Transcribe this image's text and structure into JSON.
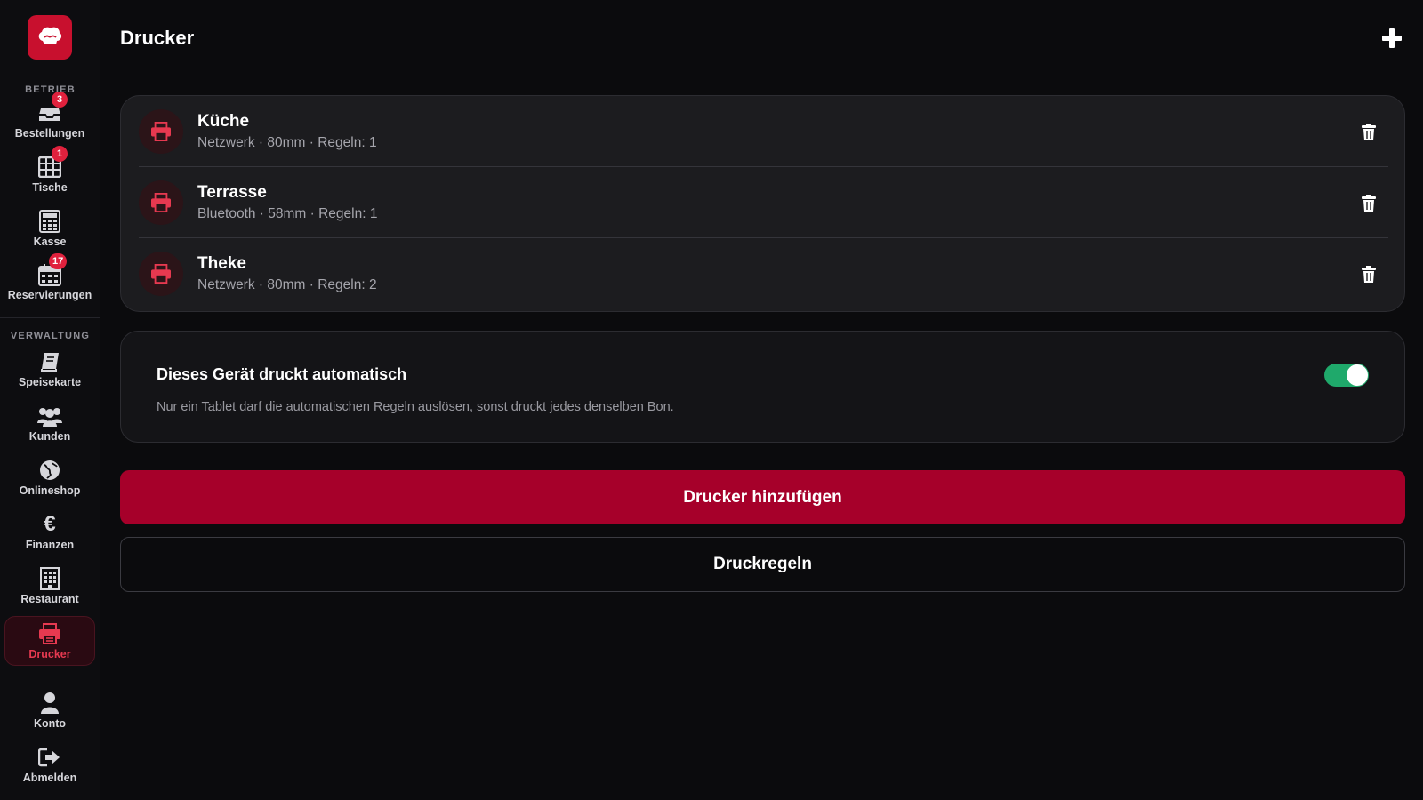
{
  "app": {
    "logo_icon": "chef-hat-icon",
    "brand_color": "#c8102e"
  },
  "sidebar": {
    "section_operation": "BETRIEB",
    "section_management": "VERWALTUNG",
    "items": [
      {
        "label": "Bestellungen",
        "icon": "inbox-tray-icon",
        "badge": "3"
      },
      {
        "label": "Tische",
        "icon": "table-grid-icon",
        "badge": "1"
      },
      {
        "label": "Kasse",
        "icon": "calculator-icon"
      },
      {
        "label": "Reservierungen",
        "icon": "calendar-icon",
        "badge": "17"
      },
      {
        "label": "Speisekarte",
        "icon": "book-icon"
      },
      {
        "label": "Kunden",
        "icon": "users-icon"
      },
      {
        "label": "Onlineshop",
        "icon": "globe-icon"
      },
      {
        "label": "Finanzen",
        "icon": "euro-icon"
      },
      {
        "label": "Restaurant",
        "icon": "building-icon"
      },
      {
        "label": "Drucker",
        "icon": "printer-icon",
        "active": true
      },
      {
        "label": "Konto",
        "icon": "user-icon"
      },
      {
        "label": "Abmelden",
        "icon": "logout-icon"
      }
    ]
  },
  "header": {
    "title": "Drucker",
    "add_icon": "plus-icon"
  },
  "printers": [
    {
      "name": "Küche",
      "meta": "Netzwerk · 80mm · Regeln: 1"
    },
    {
      "name": "Terrasse",
      "meta": "Bluetooth · 58mm · Regeln: 1"
    },
    {
      "name": "Theke",
      "meta": "Netzwerk · 80mm · Regeln: 2"
    }
  ],
  "auto_print": {
    "title": "Dieses Gerät druckt automatisch",
    "description": "Nur ein Tablet darf die automatischen Regeln auslösen, sonst druckt jedes denselben Bon.",
    "enabled": true,
    "toggle_color": "#1fa96b"
  },
  "actions": {
    "add_printer_label": "Drucker hinzufügen",
    "print_rules_label": "Druckregeln",
    "primary_color": "#a6002a"
  }
}
